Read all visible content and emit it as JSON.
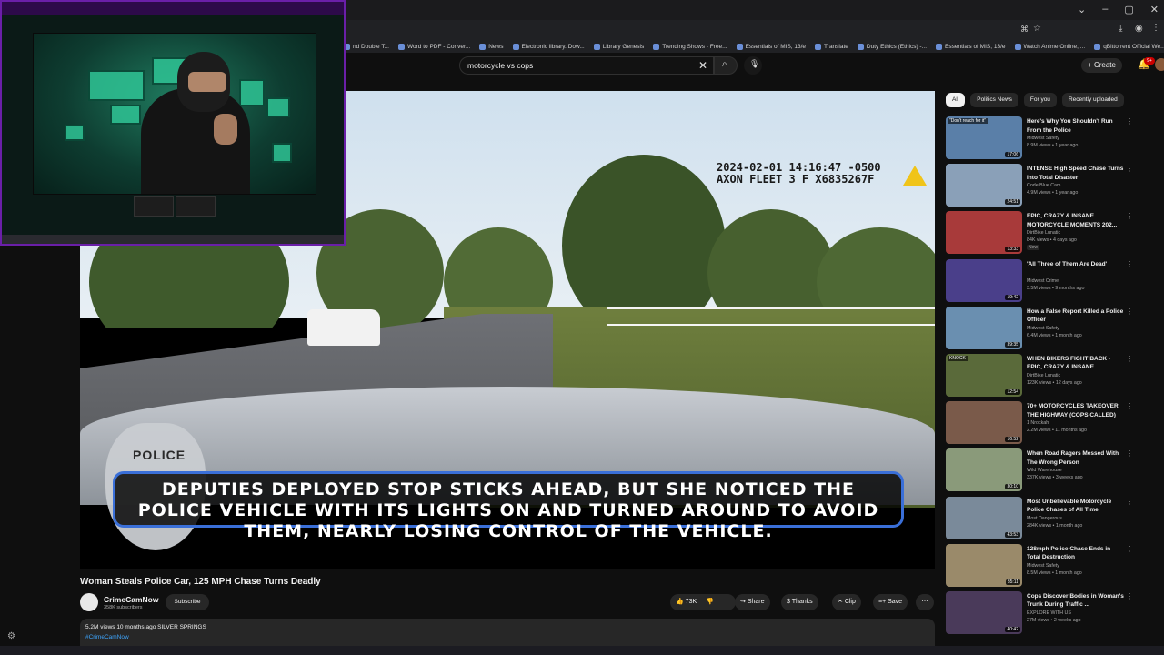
{
  "browser": {
    "bookmarks": [
      "nd Double T...",
      "Word to PDF - Conver...",
      "News",
      "Electronic library. Dow...",
      "Library Genesis",
      "Trending Shows - Free...",
      "Essentials of MIS, 13/e",
      "Translate",
      "Duty Ethics (Ethics) -...",
      "Essentials of MIS, 13/e",
      "Watch Anime Online, ...",
      "qBittorrent Official We...",
      "Other Bo"
    ]
  },
  "youtube": {
    "search": {
      "query": "motorcycle vs cops"
    },
    "header": {
      "create_label": "Create",
      "notif_count": "9+"
    },
    "video": {
      "timestamp_line1": "2024-02-01 14:16:47 -0500",
      "timestamp_line2": "AXON FLEET 3 F X6835267F",
      "caption": "Deputies deployed stop sticks ahead, but she noticed the police vehicle with its lights on and turned around to avoid them, nearly losing control of the vehicle.",
      "badge_text": "POLICE",
      "title": "Woman Steals Police Car, 125 MPH Chase Turns Deadly"
    },
    "channel": {
      "name": "CrimeCamNow",
      "subs": "358K subscribers",
      "subscribe_label": "Subscribe"
    },
    "actions": {
      "likes": "73K",
      "share": "Share",
      "thanks": "Thanks",
      "clip": "Clip",
      "save": "Save"
    },
    "description": {
      "meta": "5.2M views  10 months ago  SILVER SPRINGS",
      "hashtag": "#CrimeCamNow"
    },
    "chips": [
      "All",
      "Politics News",
      "For you",
      "Recently uploaded"
    ],
    "recommendations": [
      {
        "title": "Here's Why You Shouldn't Run From the Police",
        "channel": "Midwest Safety",
        "meta": "8.9M views • 1 year ago",
        "duration": "17:06",
        "thumb_color": "#5a7fa8",
        "thumb_label": "\"Don't reach for it\""
      },
      {
        "title": "INTENSE High Speed Chase Turns Into Total Disaster",
        "channel": "Code Blue Cam",
        "meta": "4.9M views • 1 year ago",
        "duration": "24:51",
        "thumb_color": "#8aa0b8"
      },
      {
        "title": "EPIC, CRAZY & INSANE MOTORCYCLE MOMENTS 202...",
        "channel": "DirtBike Lunatic",
        "meta": "84K views • 4 days ago",
        "badge": "New",
        "duration": "13:33",
        "thumb_color": "#a83a3a"
      },
      {
        "title": "'All Three of Them Are Dead'",
        "channel": "Midwest Crime",
        "meta": "3.5M views • 9 months ago",
        "duration": "19:42",
        "thumb_color": "#4a3f8a"
      },
      {
        "title": "How a False Report Killed a Police Officer",
        "channel": "Midwest Safety",
        "meta": "6.4M views • 1 month ago",
        "duration": "39:35",
        "thumb_color": "#6a8fb0"
      },
      {
        "title": "WHEN BIKERS FIGHT BACK - EPIC, CRAZY & INSANE ...",
        "channel": "DirtBike Lunatic",
        "meta": "123K views • 12 days ago",
        "duration": "12:54",
        "thumb_color": "#5a6a3a",
        "thumb_label": "KNOCK"
      },
      {
        "title": "70+ MOTORCYCLES TAKEOVER THE HIGHWAY (COPS CALLED)",
        "channel": "1 Nrockah",
        "meta": "2.2M views • 11 months ago",
        "duration": "16:52",
        "thumb_color": "#7a5a4a"
      },
      {
        "title": "When Road Ragers Messed With The Wrong Person",
        "channel": "Wild Warehouse",
        "meta": "337K views • 3 weeks ago",
        "duration": "30:10",
        "thumb_color": "#8a9a7a"
      },
      {
        "title": "Most Unbelievable Motorcycle Police Chases of All Time",
        "channel": "Most Dangerous",
        "meta": "284K views • 1 month ago",
        "duration": "43:53",
        "thumb_color": "#7a8a9a"
      },
      {
        "title": "128mph Police Chase Ends in Total Destruction",
        "channel": "Midwest Safety",
        "meta": "8.5M views • 1 month ago",
        "duration": "35:11",
        "thumb_color": "#9a8a6a"
      },
      {
        "title": "Cops Discover Bodies in Woman's Trunk During Traffic ...",
        "channel": "EXPLORE WITH US",
        "meta": "27M views • 2 weeks ago",
        "duration": "40:42",
        "thumb_color": "#4a3a5a"
      }
    ]
  }
}
